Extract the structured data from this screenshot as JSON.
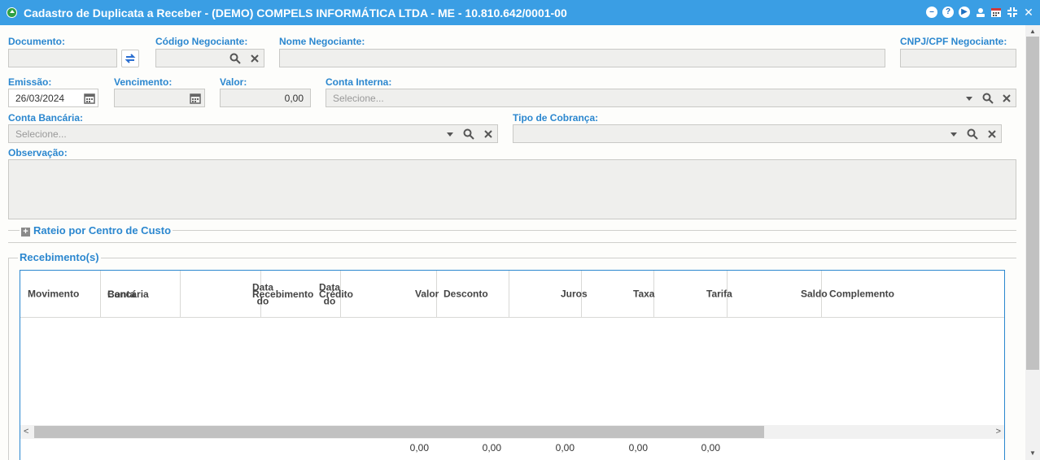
{
  "window": {
    "title": "Cadastro de Duplicata a Receber - (DEMO) COMPELS INFORMÁTICA LTDA - ME - 10.810.642/0001-00"
  },
  "form": {
    "documento": {
      "label": "Documento:",
      "value": ""
    },
    "codigo_negociante": {
      "label": "Código Negociante:",
      "value": ""
    },
    "nome_negociante": {
      "label": "Nome Negociante:",
      "value": ""
    },
    "cnpj_cpf_negociante": {
      "label": "CNPJ/CPF Negociante:",
      "value": ""
    },
    "emissao": {
      "label": "Emissão:",
      "value": "26/03/2024"
    },
    "vencimento": {
      "label": "Vencimento:",
      "value": ""
    },
    "valor": {
      "label": "Valor:",
      "value": "0,00"
    },
    "conta_interna": {
      "label": "Conta Interna:",
      "placeholder": "Selecione..."
    },
    "conta_bancaria": {
      "label": "Conta Bancária:",
      "placeholder": "Selecione..."
    },
    "tipo_cobranca": {
      "label": "Tipo de Cobrança:",
      "value": ""
    },
    "observacao": {
      "label": "Observação:",
      "value": ""
    }
  },
  "sections": {
    "rateio": {
      "title": "Rateio por Centro de Custo",
      "collapsed": true
    },
    "recebimentos": {
      "title": "Recebimento(s)"
    }
  },
  "grid": {
    "columns": [
      {
        "line1": "Movimento",
        "line2": ""
      },
      {
        "line1": "Conta",
        "line2": "Bancária"
      },
      {
        "line1": "Data do",
        "line2": "Recebimento"
      },
      {
        "line1": "Data do",
        "line2": "Crédito"
      },
      {
        "line1": "Valor",
        "line2": ""
      },
      {
        "line1": "Desconto",
        "line2": ""
      },
      {
        "line1": "Juros",
        "line2": ""
      },
      {
        "line1": "Taxa",
        "line2": ""
      },
      {
        "line1": "Tarifa",
        "line2": ""
      },
      {
        "line1": "Saldo",
        "line2": ""
      },
      {
        "line1": "Complemento",
        "line2": ""
      }
    ],
    "rows": [],
    "totals": [
      "0,00",
      "0,00",
      "0,00",
      "0,00",
      "0,00"
    ]
  },
  "colors": {
    "titlebar": "#3a9ee4",
    "label": "#2b87cf",
    "field_bg": "#efefed"
  },
  "icons": [
    "minimize-icon",
    "help-icon",
    "play-icon",
    "user-icon",
    "calendar-icon",
    "restore-icon",
    "close-icon",
    "search-icon",
    "clear-icon",
    "dropdown-icon",
    "sync-icon",
    "plus-icon"
  ]
}
